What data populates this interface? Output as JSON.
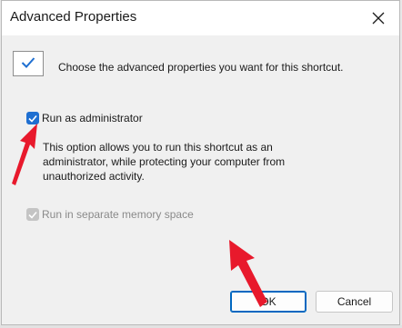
{
  "dialog": {
    "title": "Advanced Properties",
    "intro": "Choose the advanced properties you want for this shortcut."
  },
  "options": {
    "run_as_admin": {
      "label": "Run as administrator",
      "checked": true,
      "description": "This option allows you to run this shortcut as an administrator, while protecting your computer from unauthorized activity."
    },
    "separate_memory": {
      "label": "Run in separate memory space",
      "checked": true,
      "enabled": false
    }
  },
  "buttons": {
    "ok": "OK",
    "cancel": "Cancel"
  },
  "colors": {
    "accent": "#1f6fd1",
    "annotation_arrow": "#e8192c",
    "disabled_text": "#8a8a8a"
  },
  "icons": {
    "close": "close-icon",
    "header": "checkmark-icon",
    "check": "checkmark-icon"
  }
}
